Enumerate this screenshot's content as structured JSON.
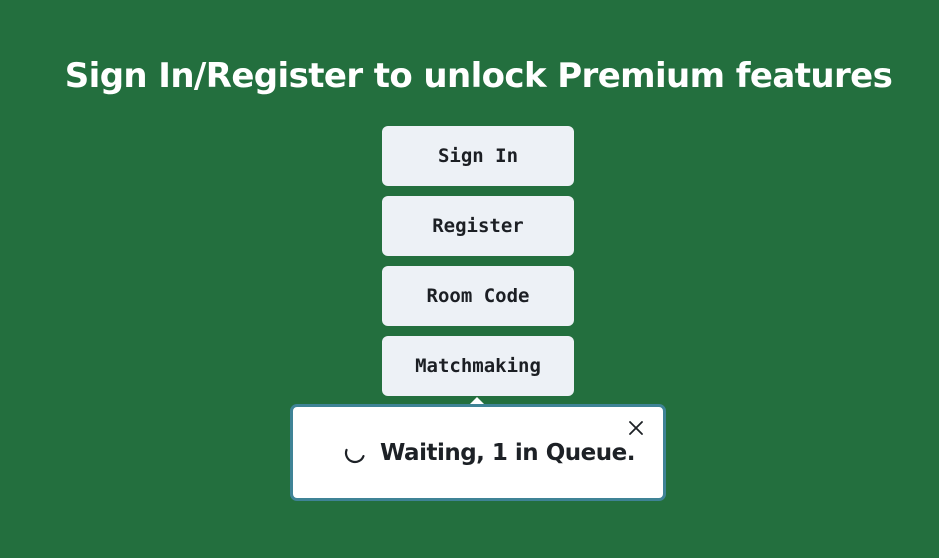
{
  "header": {
    "title": "Sign In/Register to unlock Premium features"
  },
  "menu": {
    "items": [
      {
        "label": "Sign In",
        "name": "sign-in-button"
      },
      {
        "label": "Register",
        "name": "register-button"
      },
      {
        "label": "Room Code",
        "name": "room-code-button"
      },
      {
        "label": "Matchmaking",
        "name": "matchmaking-button"
      }
    ]
  },
  "matchmaking_popover": {
    "status_text": "Waiting, 1 in Queue.",
    "spinner_icon": "loading-spinner-icon",
    "close_icon": "close-icon"
  },
  "colors": {
    "background": "#236f3e",
    "button_bg": "#edf1f6",
    "button_text": "#1c1f24",
    "popover_border": "#3f8396",
    "title_text": "#ffffff"
  }
}
